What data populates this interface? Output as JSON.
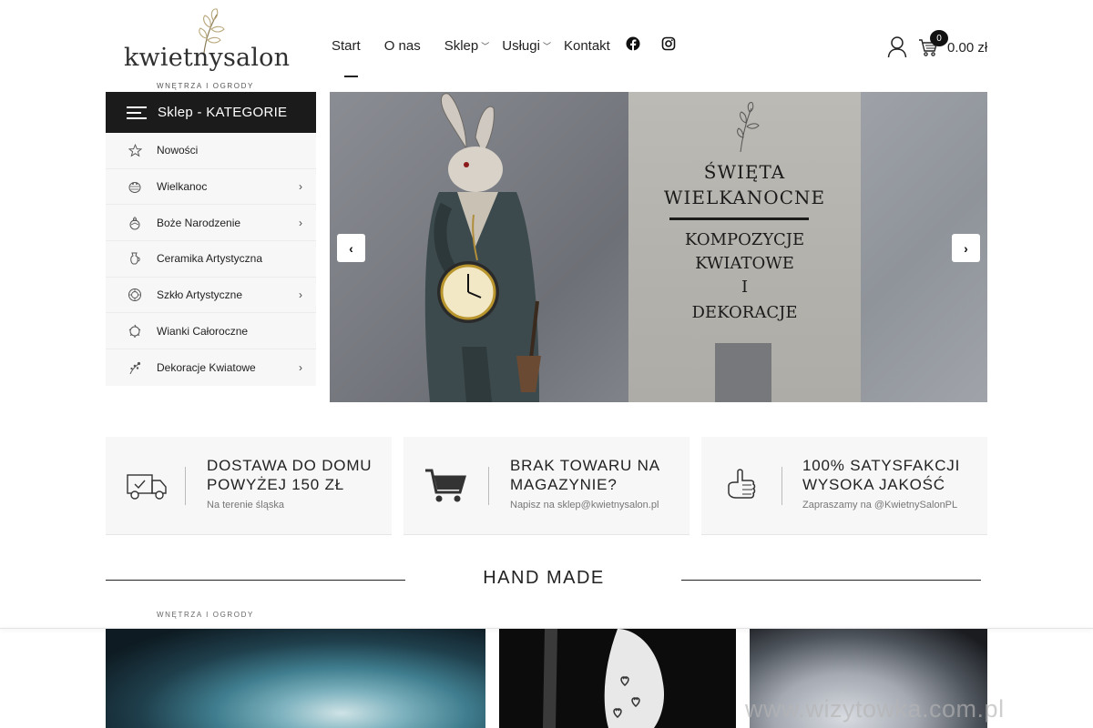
{
  "brand": {
    "name": "kwietnysalon",
    "tagline": "WNĘTRZA I OGRODY"
  },
  "nav": {
    "items": [
      {
        "label": "Start",
        "has_dropdown": false
      },
      {
        "label": "O nas",
        "has_dropdown": false
      },
      {
        "label": "Sklep",
        "has_dropdown": true
      },
      {
        "label": "Usługi",
        "has_dropdown": true
      },
      {
        "label": "Kontakt",
        "has_dropdown": false
      }
    ],
    "social": [
      "facebook-icon",
      "instagram-icon"
    ]
  },
  "cart": {
    "count": "0",
    "total": "0.00 zł"
  },
  "sidebar": {
    "title": "Sklep - KATEGORIE",
    "items": [
      {
        "label": "Nowości",
        "icon": "star-icon",
        "has_children": false
      },
      {
        "label": "Wielkanoc",
        "icon": "easter-egg-icon",
        "has_children": true
      },
      {
        "label": "Boże Narodzenie",
        "icon": "christmas-ornament-icon",
        "has_children": true
      },
      {
        "label": "Ceramika Artystyczna",
        "icon": "ceramics-icon",
        "has_children": false
      },
      {
        "label": "Szkło Artystyczne",
        "icon": "glass-icon",
        "has_children": true
      },
      {
        "label": "Wianki Całoroczne",
        "icon": "wreath-icon",
        "has_children": false
      },
      {
        "label": "Dekoracje Kwiatowe",
        "icon": "flower-icon",
        "has_children": true
      }
    ]
  },
  "slider": {
    "line1": "ŚWIĘTA",
    "line2": "WIELKANOCNE",
    "line3": "KOMPOZYCJE",
    "line4": "KWIATOWE",
    "line5": "I",
    "line6": "DEKORACJE",
    "prev_icon": "chevron-left-icon",
    "next_icon": "chevron-right-icon"
  },
  "features": [
    {
      "title_1": "DOSTAWA DO DOMU",
      "title_2": "POWYŻEJ 150 ZŁ",
      "subtitle": "Na terenie śląska",
      "icon": "delivery-truck-icon"
    },
    {
      "title_1": "BRAK TOWARU NA",
      "title_2": "MAGAZYNIE?",
      "subtitle": "Napisz na sklep@kwietnysalon.pl",
      "icon": "shopping-cart-icon"
    },
    {
      "title_1": "100% SATYSFAKCJI",
      "title_2": "WYSOKA JAKOŚĆ",
      "subtitle": "Zapraszamy na @KwietnySalonPL",
      "icon": "thumbs-up-icon"
    }
  ],
  "section": {
    "title": "HAND MADE"
  },
  "watermark": "www.wizytowka.com.pl"
}
